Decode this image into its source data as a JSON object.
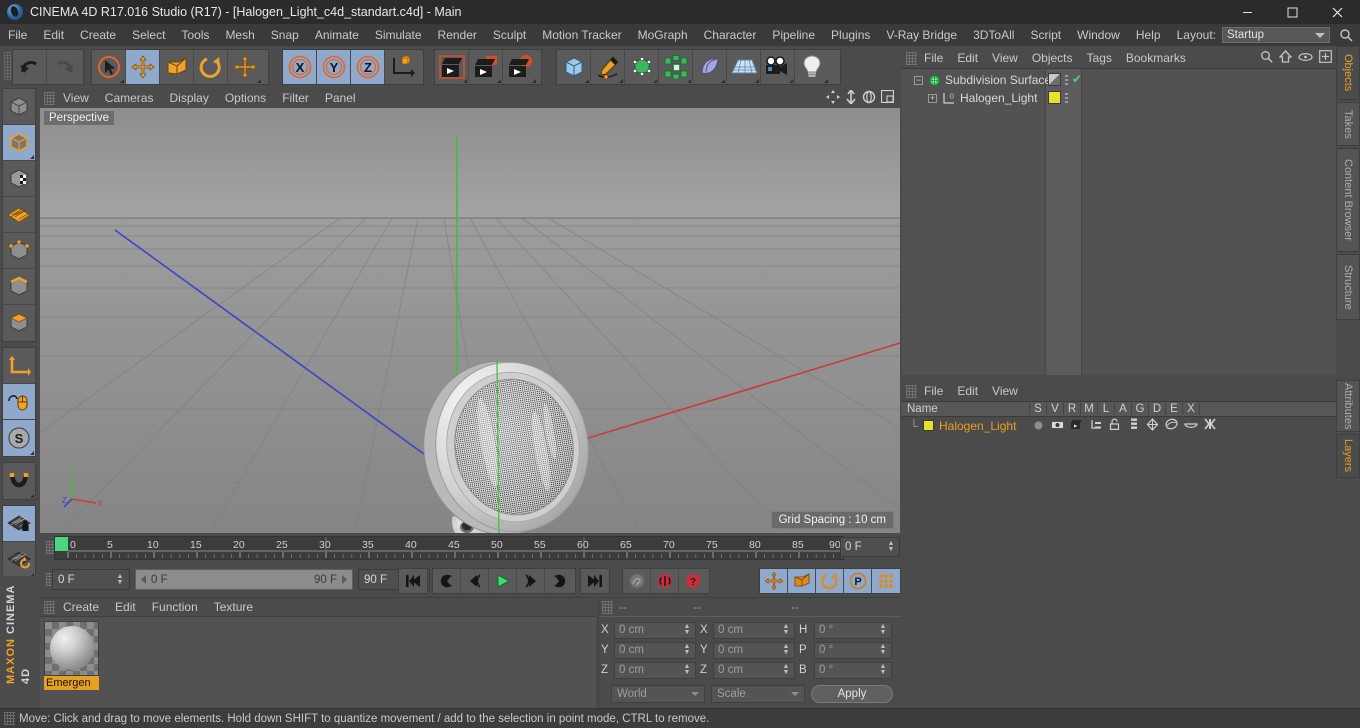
{
  "window": {
    "title": "CINEMA 4D R17.016 Studio (R17) - [Halogen_Light_c4d_standart.c4d] - Main",
    "minimize": "–",
    "maximize": "❐",
    "close": "✕"
  },
  "menubar": {
    "items": [
      "File",
      "Edit",
      "Create",
      "Select",
      "Tools",
      "Mesh",
      "Snap",
      "Animate",
      "Simulate",
      "Render",
      "Sculpt",
      "Motion Tracker",
      "MoGraph",
      "Character",
      "Pipeline",
      "Plugins",
      "V-Ray Bridge",
      "3DToAll",
      "Script",
      "Window",
      "Help"
    ],
    "layout_label": "Layout:",
    "layout_value": "Startup",
    "search_icon": "search-icon"
  },
  "toolbar": {
    "groups": [
      {
        "name": "undo-redo",
        "buttons": [
          {
            "icon": "undo-icon",
            "label": "Undo",
            "active": false,
            "corner": false
          },
          {
            "icon": "redo-icon",
            "label": "Redo",
            "active": false,
            "corner": false
          }
        ]
      },
      {
        "name": "transform-tools",
        "buttons": [
          {
            "icon": "live-selection-icon",
            "label": "Live Selection",
            "active": false,
            "corner": true
          },
          {
            "icon": "move-icon",
            "label": "Move",
            "active": true,
            "corner": false
          },
          {
            "icon": "scale-icon",
            "label": "Scale",
            "active": false,
            "corner": false
          },
          {
            "icon": "rotate-icon",
            "label": "Rotate",
            "active": false,
            "corner": false
          },
          {
            "icon": "move-alt-icon",
            "label": "Move Tool Variant",
            "active": false,
            "corner": true
          }
        ]
      },
      {
        "name": "axis-locks",
        "buttons": [
          {
            "icon": "axis-x-icon",
            "label": "X Axis",
            "active": true,
            "corner": false
          },
          {
            "icon": "axis-y-icon",
            "label": "Y Axis",
            "active": true,
            "corner": false
          },
          {
            "icon": "axis-z-icon",
            "label": "Z Axis",
            "active": true,
            "corner": false
          },
          {
            "icon": "world-coordinate-icon",
            "label": "World / Object Coordinate System",
            "active": false,
            "corner": false
          }
        ]
      },
      {
        "name": "render-tools",
        "buttons": [
          {
            "icon": "render-view-icon",
            "label": "Render View",
            "active": false,
            "corner": true
          },
          {
            "icon": "render-region-icon",
            "label": "Render to Picture Viewer",
            "active": false,
            "corner": true
          },
          {
            "icon": "render-settings-icon",
            "label": "Edit Render Settings",
            "active": false,
            "corner": true
          }
        ]
      },
      {
        "name": "create-objects",
        "buttons": [
          {
            "icon": "cube-primitive-icon",
            "label": "Add Cube Object",
            "active": false,
            "corner": true
          },
          {
            "icon": "spline-pen-icon",
            "label": "Add Spline",
            "active": false,
            "corner": true
          },
          {
            "icon": "nurbs-icon",
            "label": "Add Generator Object",
            "active": false,
            "corner": true
          },
          {
            "icon": "array-icon",
            "label": "Add Modeling Object",
            "active": false,
            "corner": true
          },
          {
            "icon": "deformer-icon",
            "label": "Add Deformer Object",
            "active": false,
            "corner": true
          },
          {
            "icon": "scene-floor-icon",
            "label": "Add Environment Object",
            "active": false,
            "corner": true
          },
          {
            "icon": "camera-icon",
            "label": "Add Camera Object",
            "active": false,
            "corner": true
          },
          {
            "icon": "light-icon",
            "label": "Add Light Object",
            "active": false,
            "corner": true
          }
        ]
      }
    ]
  },
  "left_toolbar": {
    "groups": [
      {
        "name": "selection-mode",
        "buttons": [
          {
            "icon": "make-editable-icon",
            "label": "Make Editable",
            "active": false,
            "corner": false
          },
          {
            "icon": "model-mode-icon",
            "label": "Model Mode",
            "active": true,
            "corner": true
          },
          {
            "icon": "texture-mode-icon",
            "label": "Texture Mode",
            "active": false,
            "corner": false
          },
          {
            "icon": "uv-mesh-icon",
            "label": "Viewport Solo Off",
            "active": false,
            "corner": false
          },
          {
            "icon": "points-mode-icon",
            "label": "Points Mode",
            "active": false,
            "corner": false
          },
          {
            "icon": "edges-mode-icon",
            "label": "Edges Mode",
            "active": false,
            "corner": false
          },
          {
            "icon": "polygons-mode-icon",
            "label": "Polygons Mode",
            "active": false,
            "corner": false
          }
        ]
      },
      {
        "name": "axis-modes",
        "buttons": [
          {
            "icon": "enable-axis-icon",
            "label": "Enable Axis Modification",
            "active": false,
            "corner": false
          },
          {
            "icon": "enable-snap-mouse-icon",
            "label": "Viewport / Mouse Tool",
            "active": true,
            "corner": false
          },
          {
            "icon": "soft-selection-icon",
            "label": "Soft Interaction",
            "active": true,
            "corner": true
          }
        ]
      },
      {
        "name": "snap-group",
        "buttons": [
          {
            "icon": "magnet-snap-icon",
            "label": "Enable Snap",
            "active": false,
            "corner": true
          }
        ]
      },
      {
        "name": "workplane-group",
        "buttons": [
          {
            "icon": "workplane-lock-icon",
            "label": "Lock Workplane",
            "active": true,
            "corner": false
          },
          {
            "icon": "workplane-rotate-icon",
            "label": "Planar Workplane Mode",
            "active": false,
            "corner": true
          }
        ]
      }
    ],
    "brand_top": "MAXON",
    "brand_bottom": "CINEMA 4D"
  },
  "viewport": {
    "menu": [
      "View",
      "Cameras",
      "Display",
      "Options",
      "Filter",
      "Panel"
    ],
    "nav_icons": [
      "pan-icon",
      "dolly-icon",
      "orbit-icon",
      "maximize-view-icon"
    ],
    "perspective_label": "Perspective",
    "grid_spacing": "Grid Spacing : 10 cm",
    "axis_labels": {
      "x": "X",
      "y": "Y",
      "z": "Z"
    },
    "colors": {
      "x_axis": "#cc3333",
      "y_axis": "#33bb33",
      "z_axis": "#3344cc"
    },
    "object_description": "Halogen light reflector, shaded grey with dotted mesh lens"
  },
  "timeline": {
    "ticks": [
      "0",
      "5",
      "10",
      "15",
      "20",
      "25",
      "30",
      "35",
      "40",
      "45",
      "50",
      "55",
      "60",
      "65",
      "70",
      "75",
      "80",
      "85",
      "90"
    ],
    "current_frame_field": "0 F",
    "playhead_frame": 0
  },
  "transport": {
    "current_frame": "0 F",
    "range_start": "0 F",
    "range_end": "90 F",
    "max_frame": "90 F",
    "buttons": [
      {
        "icon": "go-to-start-icon",
        "label": "Go to Start",
        "active": false
      },
      {
        "icon": "record-active-objects-icon",
        "label": "Record Active Objects",
        "active": false
      },
      {
        "icon": "step-back-icon",
        "label": "Go to Previous Frame",
        "active": false
      },
      {
        "icon": "play-icon",
        "label": "Play Forwards",
        "active": false
      },
      {
        "icon": "step-forward-icon",
        "label": "Go to Next Frame",
        "active": false
      },
      {
        "icon": "loop-icon",
        "label": "Play Mode / Loop",
        "active": false
      },
      {
        "icon": "go-to-end-icon",
        "label": "Go to End",
        "active": false
      },
      {
        "icon": "autokey-icon",
        "label": "Autokeying",
        "active": false
      },
      {
        "icon": "key-record-icon",
        "label": "Record Keyframe",
        "active": false
      },
      {
        "icon": "keyframe-selection-icon",
        "label": "Keyframe Selection",
        "active": false
      },
      {
        "icon": "position-key-icon",
        "label": "Position",
        "active": true
      },
      {
        "icon": "scale-key-icon",
        "label": "Scale",
        "active": true
      },
      {
        "icon": "rotation-key-icon",
        "label": "Rotation",
        "active": true
      },
      {
        "icon": "pla-key-icon",
        "label": "Parameter / PLA",
        "active": true
      },
      {
        "icon": "point-level-anim-icon",
        "label": "Point Level Animation",
        "active": true
      },
      {
        "icon": "timeline-filmstrip-icon",
        "label": "Timeline / Animation Layout",
        "active": true
      }
    ]
  },
  "materials": {
    "menu": [
      "Create",
      "Edit",
      "Function",
      "Texture"
    ],
    "items": [
      {
        "name": "Emergen",
        "icon": "material-sphere-icon"
      }
    ]
  },
  "coordinates": {
    "header": [
      "--",
      "--",
      "--"
    ],
    "rows": [
      {
        "label1": "X",
        "value1": "0 cm",
        "label2": "X",
        "value2": "0 cm",
        "label3": "H",
        "value3": "0 °"
      },
      {
        "label1": "Y",
        "value1": "0 cm",
        "label2": "Y",
        "value2": "0 cm",
        "label3": "P",
        "value3": "0 °"
      },
      {
        "label1": "Z",
        "value1": "0 cm",
        "label2": "Z",
        "value2": "0 cm",
        "label3": "B",
        "value3": "0 °"
      }
    ],
    "system": "World",
    "mode": "Scale",
    "apply": "Apply"
  },
  "object_manager": {
    "menu": [
      "File",
      "Edit",
      "View",
      "Objects",
      "Tags",
      "Bookmarks"
    ],
    "icons": [
      "search-icon",
      "home-icon",
      "eye-icon",
      "new-layer-icon"
    ],
    "rows": [
      {
        "name": "Subdivision Surface",
        "icon": "subdivision-surface-icon",
        "depth": 0,
        "tag_color": "#8a8a8a",
        "checked": true
      },
      {
        "name": "Halogen_Light",
        "icon": "light-object-icon",
        "depth": 1,
        "tag_color": "#e8e02a",
        "checked": false
      }
    ]
  },
  "layers_panel": {
    "menu": [
      "File",
      "Edit",
      "View"
    ],
    "columns": [
      "Name",
      "S",
      "V",
      "R",
      "M",
      "L",
      "A",
      "G",
      "D",
      "E",
      "X"
    ],
    "rows": [
      {
        "name": "Halogen_Light",
        "swatch": "#e8e02a",
        "icons": [
          "solo-dot-icon",
          "visible-icon",
          "render-icon",
          "manager-icon",
          "lock-icon",
          "animation-icon",
          "generators-icon",
          "deformers-icon",
          "expressions-icon",
          "xref-icon"
        ]
      }
    ]
  },
  "right_rail": {
    "tabs": [
      {
        "label": "Objects",
        "active": true
      },
      {
        "label": "Takes",
        "active": false
      },
      {
        "label": "Content Browser",
        "active": false
      },
      {
        "label": "Structure",
        "active": false
      },
      {
        "label": "Attributes",
        "active": false
      },
      {
        "label": "Layers",
        "active": true
      }
    ]
  },
  "statusbar": {
    "text": "Move: Click and drag to move elements. Hold down SHIFT to quantize movement / add to the selection in point mode, CTRL to remove."
  },
  "theme": {
    "bg": "#4b4b4b",
    "panel": "#525252",
    "accent_orange": "#e8a020",
    "active_blue": "#8fa9cc",
    "text": "#c8c8c8"
  }
}
